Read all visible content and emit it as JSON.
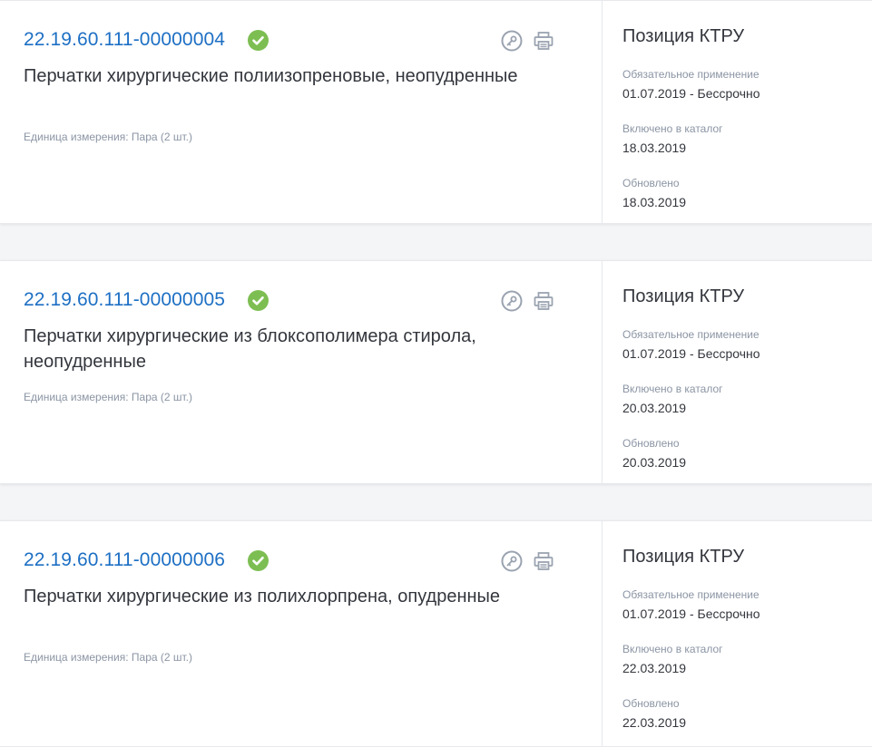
{
  "colors": {
    "link": "#1d6fc4",
    "check": "#7dbe52",
    "icon": "#9aa3b0",
    "muted": "#8b95a4",
    "text": "#33363d"
  },
  "icons": [
    "check-circle-icon",
    "key-icon",
    "print-icon"
  ],
  "cards": [
    {
      "code": "22.19.60.111-00000004",
      "title": "Перчатки хирургические полиизопреновые, неопудренные",
      "unit": "Единица измерения: Пара (2 шт.)",
      "side_title": "Позиция КТРУ",
      "mandatory_label": "Обязательное применение",
      "mandatory_value": "01.07.2019  - Бессрочно",
      "included_label": "Включено в каталог",
      "included_value": "18.03.2019",
      "updated_label": "Обновлено",
      "updated_value": "18.03.2019"
    },
    {
      "code": "22.19.60.111-00000005",
      "title": "Перчатки хирургические из блоксополимера стирола, неопудренные",
      "unit": "Единица измерения: Пара (2 шт.)",
      "side_title": "Позиция КТРУ",
      "mandatory_label": "Обязательное применение",
      "mandatory_value": "01.07.2019  - Бессрочно",
      "included_label": "Включено в каталог",
      "included_value": "20.03.2019",
      "updated_label": "Обновлено",
      "updated_value": "20.03.2019"
    },
    {
      "code": "22.19.60.111-00000006",
      "title": "Перчатки хирургические из полихлорпрена, опудренные",
      "unit": "Единица измерения: Пара (2 шт.)",
      "side_title": "Позиция КТРУ",
      "mandatory_label": "Обязательное применение",
      "mandatory_value": "01.07.2019  - Бессрочно",
      "included_label": "Включено в каталог",
      "included_value": "22.03.2019",
      "updated_label": "Обновлено",
      "updated_value": "22.03.2019"
    }
  ]
}
